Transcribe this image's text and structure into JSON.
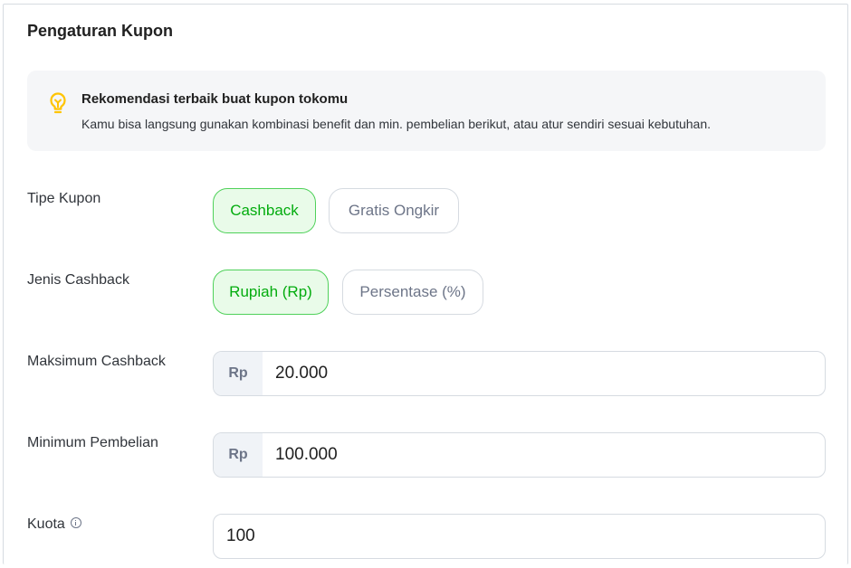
{
  "section_title": "Pengaturan Kupon",
  "recommendation": {
    "title": "Rekomendasi terbaik buat kupon tokomu",
    "description": "Kamu bisa langsung gunakan kombinasi benefit dan min. pembelian berikut, atau atur sendiri sesuai kebutuhan.",
    "icon": "lightbulb-icon"
  },
  "coupon_type": {
    "label": "Tipe Kupon",
    "options": [
      "Cashback",
      "Gratis Ongkir"
    ],
    "selected": "Cashback"
  },
  "cashback_kind": {
    "label": "Jenis Cashback",
    "options": [
      "Rupiah (Rp)",
      "Persentase (%)"
    ],
    "selected": "Rupiah (Rp)"
  },
  "max_cashback": {
    "label": "Maksimum Cashback",
    "prefix": "Rp",
    "value": "20.000"
  },
  "min_purchase": {
    "label": "Minimum Pembelian",
    "prefix": "Rp",
    "value": "100.000"
  },
  "quota": {
    "label": "Kuota",
    "value": "100",
    "icon": "info-icon"
  },
  "colors": {
    "accent_green": "#03ac0e",
    "accent_green_bg": "#e9fbe9",
    "bulb_yellow": "#ffc400"
  }
}
